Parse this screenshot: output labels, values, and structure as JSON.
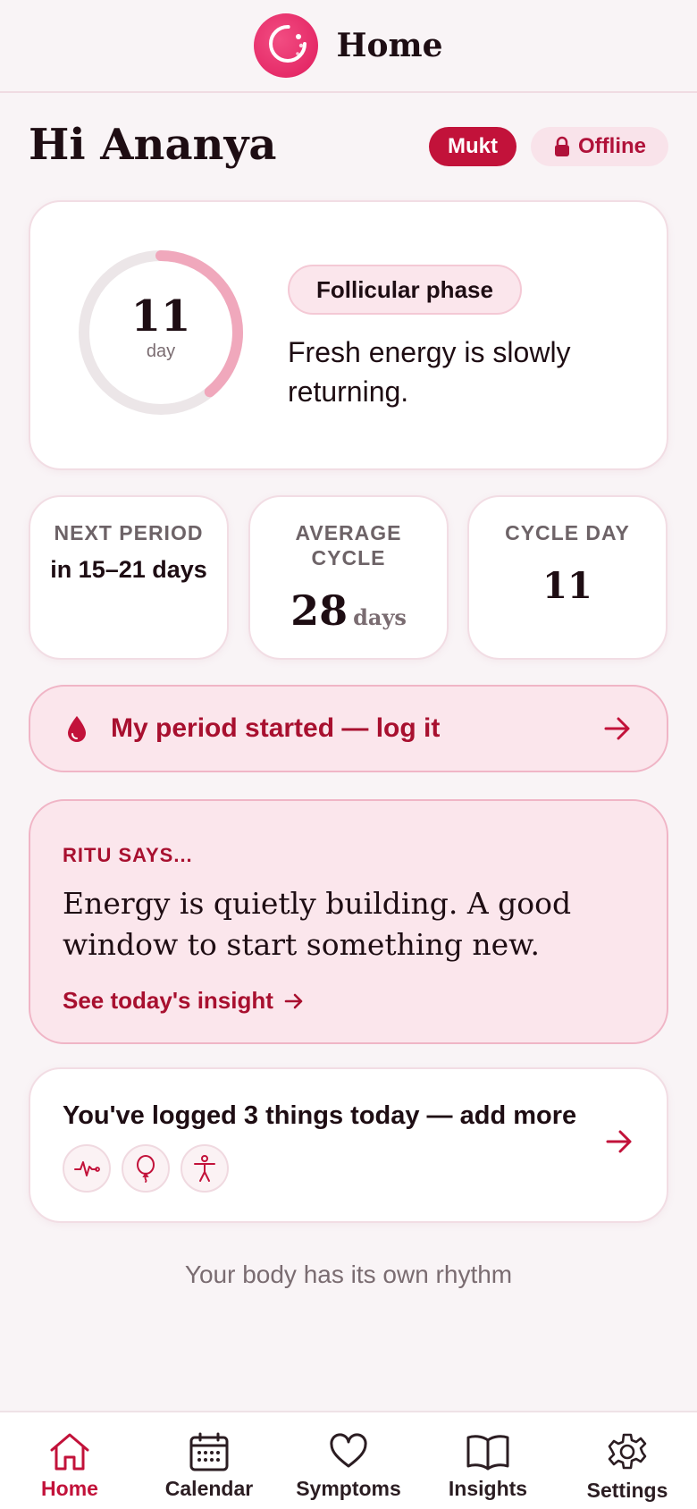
{
  "header": {
    "title": "Home",
    "logo_icon": "moon-dot-logo"
  },
  "greeting": "Hi Ananya",
  "badges": {
    "mukt": "Mukt",
    "offline": "Offline",
    "offline_icon": "lock-icon"
  },
  "phase": {
    "day_number": "11",
    "day_label": "day",
    "phase_name": "Follicular phase",
    "description": "Fresh energy is slowly returning.",
    "progress_fraction": 0.39
  },
  "stats": {
    "next_period": {
      "label": "NEXT PERIOD",
      "value": "in 15–21 days"
    },
    "average_cycle": {
      "label": "AVERAGE CYCLE",
      "value": "28",
      "unit": "days"
    },
    "cycle_day": {
      "label": "CYCLE DAY",
      "value": "11"
    }
  },
  "log_period": {
    "label": "My period started — log it",
    "icon": "drop-icon"
  },
  "ritu": {
    "kicker": "RITU SAYS...",
    "message": "Energy is quietly building. A good window to start something new.",
    "link": "See today's insight"
  },
  "logged": {
    "title": "You've logged 3 things today — add more",
    "icons": [
      "pulse-icon",
      "balloon-icon",
      "figure-icon"
    ]
  },
  "footer_text": "Your body has its own rhythm",
  "nav": [
    {
      "label": "Home",
      "icon": "home-icon",
      "active": true
    },
    {
      "label": "Calendar",
      "icon": "calendar-icon"
    },
    {
      "label": "Symptoms",
      "icon": "heart-icon"
    },
    {
      "label": "Insights",
      "icon": "book-icon"
    },
    {
      "label": "Settings",
      "icon": "gear-icon"
    }
  ],
  "colors": {
    "accent": "#c2123a",
    "accent_light": "#fbe6ec",
    "ring": "#f0a8bc",
    "background": "#f9f4f6"
  }
}
